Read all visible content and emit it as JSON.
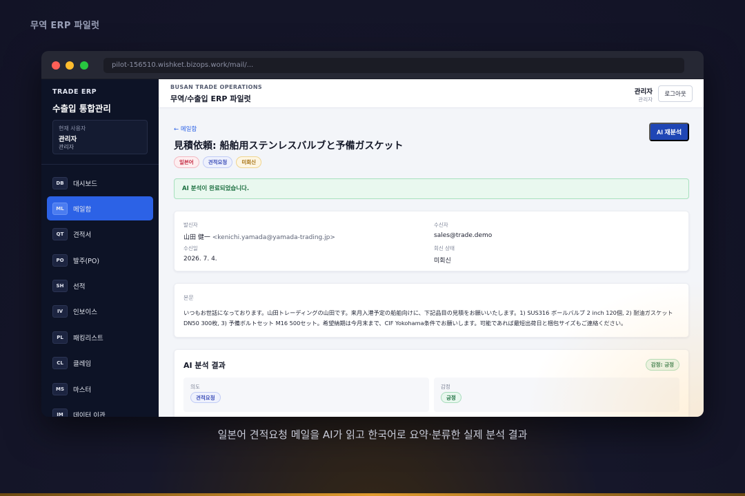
{
  "page": {
    "title": "무역 ERP 파일럿",
    "caption": "일본어 견적요청 메일을 AI가 읽고 한국어로 요약·분류한 실제 분석 결과"
  },
  "browser": {
    "url": "pilot-156510.wishket.bizops.work/mail/..."
  },
  "sidebar": {
    "brand_small": "TRADE ERP",
    "brand_big": "수출입 통합관리",
    "user_label": "현재 사용자",
    "user_name": "관리자",
    "user_role": "관리자",
    "items": [
      {
        "code": "DB",
        "label": "대시보드"
      },
      {
        "code": "ML",
        "label": "메일함"
      },
      {
        "code": "QT",
        "label": "견적서"
      },
      {
        "code": "PO",
        "label": "발주(PO)"
      },
      {
        "code": "SH",
        "label": "선적"
      },
      {
        "code": "IV",
        "label": "인보이스"
      },
      {
        "code": "PL",
        "label": "패킹리스트"
      },
      {
        "code": "CL",
        "label": "클레임"
      },
      {
        "code": "MS",
        "label": "마스터"
      },
      {
        "code": "IM",
        "label": "데이터 이관"
      }
    ]
  },
  "topbar": {
    "kicker": "BUSAN TRADE OPERATIONS",
    "title": "무역/수출입 ERP 파일럿",
    "user_name": "관리자",
    "user_role": "관리자",
    "logout_label": "로그아웃"
  },
  "mail": {
    "back_label": "← 메일함",
    "reanalyze_label": "AI 재분석",
    "subject": "見積依頼: 船舶用ステンレスバルブと予備ガスケット",
    "tags": [
      "일본어",
      "견적요청",
      "미회신"
    ],
    "alert": "AI 분석이 완료되었습니다.",
    "sender_label": "발신자",
    "sender_name": "山田 健一",
    "sender_email": "<kenichi.yamada@yamada-trading.jp>",
    "recipient_label": "수신자",
    "recipient": "sales@trade.demo",
    "received_label": "수신일",
    "received": "2026. 7. 4.",
    "reply_status_label": "회신 상태",
    "reply_status": "미회신",
    "body_label": "본문",
    "body": "いつもお世話になっております。山田トレーディングの山田です。来月入港予定の船舶向けに、下記品目の見積をお願いいたします。1) SUS316 ボールバルブ 2 inch 120個, 2) 耐油ガスケット DN50 300枚, 3) 予備ボルトセット M16 500セット。希望納期は今月末まで、CIF Yokohama条件でお願いします。可能であれば最短出荷日と梱包サイズもご連絡ください。"
  },
  "ai": {
    "title": "AI 분석 결과",
    "sentiment_pill": "감정: 긍정",
    "intent_label": "의도",
    "intent_value": "견적요청",
    "sentiment_label": "감정",
    "sentiment_value": "긍정"
  }
}
